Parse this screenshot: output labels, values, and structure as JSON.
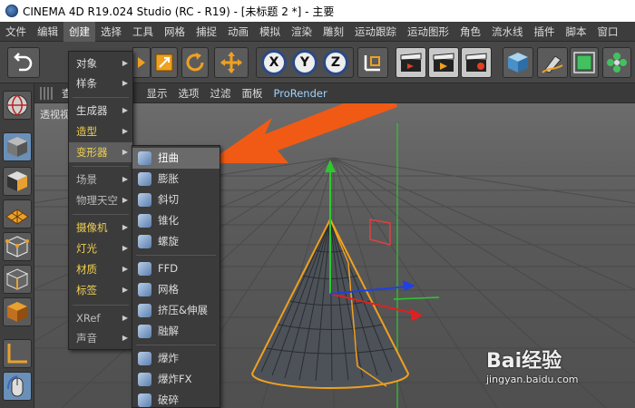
{
  "window": {
    "title": "CINEMA 4D R19.024 Studio (RC - R19) - [未标题 2 *] - 主要"
  },
  "menubar": {
    "items": [
      "文件",
      "编辑",
      "创建",
      "选择",
      "工具",
      "网格",
      "捕捉",
      "动画",
      "模拟",
      "渲染",
      "雕刻",
      "运动跟踪",
      "运动图形",
      "角色",
      "流水线",
      "插件",
      "脚本",
      "窗口"
    ]
  },
  "toolbar": {
    "axes": [
      "X",
      "Y",
      "Z"
    ]
  },
  "viewport": {
    "menu_items": [
      "查",
      "显示",
      "选项",
      "过滤",
      "面板",
      "ProRender"
    ],
    "label": "透视视"
  },
  "create_menu": {
    "items": [
      {
        "label": "对象",
        "submenu": true,
        "style": "normal"
      },
      {
        "label": "样条",
        "submenu": true,
        "style": "normal"
      },
      {
        "label": "生成器",
        "submenu": true,
        "style": "normal"
      },
      {
        "label": "造型",
        "submenu": true,
        "style": "yellow"
      },
      {
        "label": "变形器",
        "submenu": true,
        "style": "highlight"
      },
      {
        "label": "场景",
        "submenu": true,
        "style": "gray"
      },
      {
        "label": "物理天空",
        "submenu": true,
        "style": "gray"
      },
      {
        "label": "摄像机",
        "submenu": true,
        "style": "yellow"
      },
      {
        "label": "灯光",
        "submenu": true,
        "style": "yellow"
      },
      {
        "label": "材质",
        "submenu": true,
        "style": "yellow"
      },
      {
        "label": "标签",
        "submenu": true,
        "style": "yellow"
      },
      {
        "label": "XRef",
        "submenu": true,
        "style": "gray"
      },
      {
        "label": "声音",
        "submenu": true,
        "style": "gray"
      }
    ]
  },
  "deformer_menu": {
    "items": [
      "扭曲",
      "膨胀",
      "斜切",
      "锥化",
      "螺旋",
      "FFD",
      "网格",
      "挤压&伸展",
      "融解",
      "爆炸",
      "爆炸FX",
      "破碎"
    ]
  },
  "watermark": {
    "brand": "Bai经验",
    "url": "jingyan.baidu.com"
  },
  "colors": {
    "arrow": "#f05a14",
    "cone_outline": "#f0a020",
    "axis_y": "#2ec82e",
    "axis_x": "#e02020",
    "axis_z": "#2040e0",
    "menu_highlight_text": "#f0d050"
  }
}
